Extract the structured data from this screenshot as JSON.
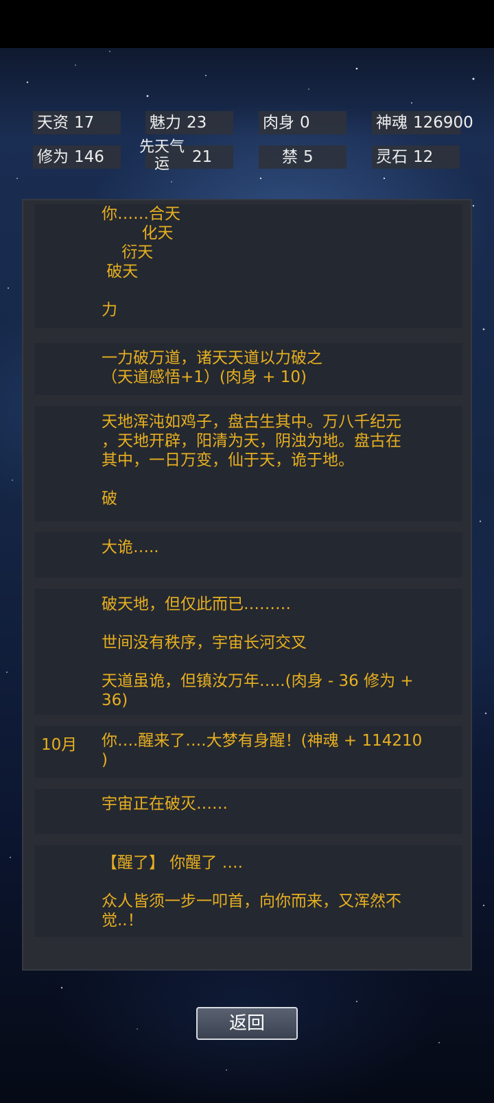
{
  "stats": [
    {
      "label": "天资",
      "value": "17"
    },
    {
      "label": "魅力",
      "value": "23"
    },
    {
      "label": "肉身",
      "value": "0"
    },
    {
      "label": "神魂",
      "value": "126900"
    },
    {
      "label": "修为",
      "value": "146"
    },
    {
      "label_line1": "先天气",
      "label_line2": "运",
      "value": "21"
    },
    {
      "label": "禁",
      "value": "5"
    },
    {
      "label": "灵石",
      "value": "12"
    }
  ],
  "entries": [
    {
      "age": "",
      "lines": [
        "你……合天",
        "        化天",
        "    衍天",
        " 破天",
        "",
        "力"
      ]
    },
    {
      "age": "",
      "lines": [
        "一力破万道，诸天天道以力破之",
        "（天道感悟+1）(肉身 + 10)"
      ]
    },
    {
      "age": "",
      "lines": [
        "天地浑沌如鸡子，盘古生其中。万八千纪元",
        "，天地开辟，阳清为天，阴浊为地。盘古在",
        "其中，一日万变，仙于天，诡于地。",
        "",
        "破"
      ]
    },
    {
      "age": "",
      "lines": [
        "大诡….."
      ]
    },
    {
      "age": "",
      "lines": [
        "破天地，但仅此而已………",
        "",
        "世间没有秩序，宇宙长河交叉",
        "",
        "天道虽诡，但镇汝万年…..(肉身 - 36 修为 +",
        "36)"
      ]
    },
    {
      "age": "10月",
      "lines": [
        "你….醒来了….大梦有身醒！(神魂 + 114210",
        ")"
      ]
    },
    {
      "age": "",
      "lines": [
        "宇宙正在破灭……"
      ]
    },
    {
      "age": "",
      "lines": [
        "【醒了】 你醒了 ….",
        "",
        "众人皆须一步一叩首，向你而来，又浑然不",
        "觉..！"
      ]
    }
  ],
  "back_button": "返回"
}
